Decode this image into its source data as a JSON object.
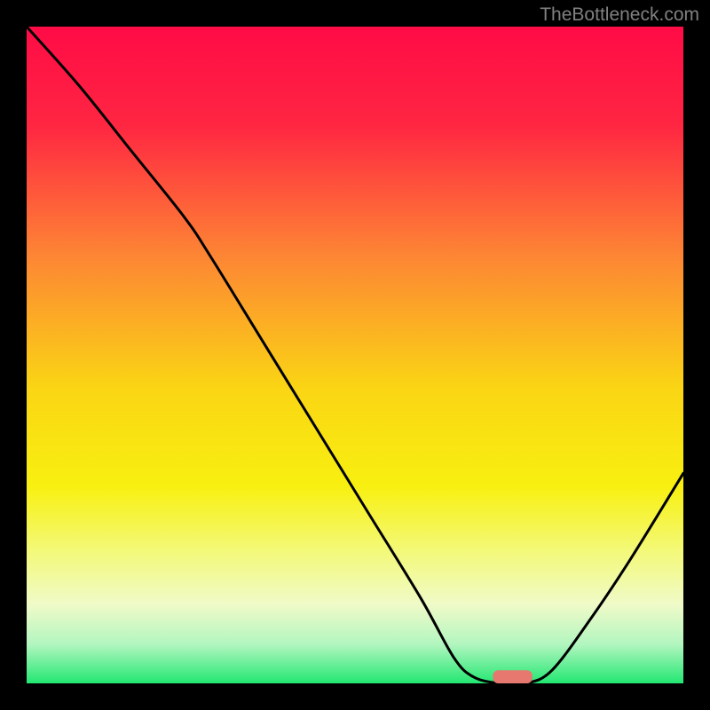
{
  "watermark": "TheBottleneck.com",
  "chart_data": {
    "type": "line",
    "title": "",
    "xlabel": "",
    "ylabel": "",
    "xlim": [
      0,
      100
    ],
    "ylim": [
      0,
      100
    ],
    "background_gradient": {
      "stops": [
        {
          "offset": 0,
          "color": "#ff0b46"
        },
        {
          "offset": 15,
          "color": "#ff2642"
        },
        {
          "offset": 35,
          "color": "#fd8634"
        },
        {
          "offset": 55,
          "color": "#fad514"
        },
        {
          "offset": 70,
          "color": "#f8f010"
        },
        {
          "offset": 80,
          "color": "#f3f97a"
        },
        {
          "offset": 88,
          "color": "#f0fac8"
        },
        {
          "offset": 94,
          "color": "#b3f6c0"
        },
        {
          "offset": 100,
          "color": "#23e772"
        }
      ]
    },
    "series": [
      {
        "name": "bottleneck-curve",
        "color": "#000000",
        "x": [
          0,
          8,
          16,
          24,
          28,
          36,
          44,
          52,
          60,
          65,
          68,
          72,
          76,
          80,
          86,
          92,
          100
        ],
        "y": [
          100,
          91,
          81,
          71,
          65,
          52,
          39,
          26,
          13,
          4,
          1,
          0,
          0,
          2,
          10,
          19,
          32
        ]
      }
    ],
    "marker": {
      "x": 74,
      "y": 0,
      "width": 6,
      "height": 2,
      "color": "#e7786f"
    }
  }
}
